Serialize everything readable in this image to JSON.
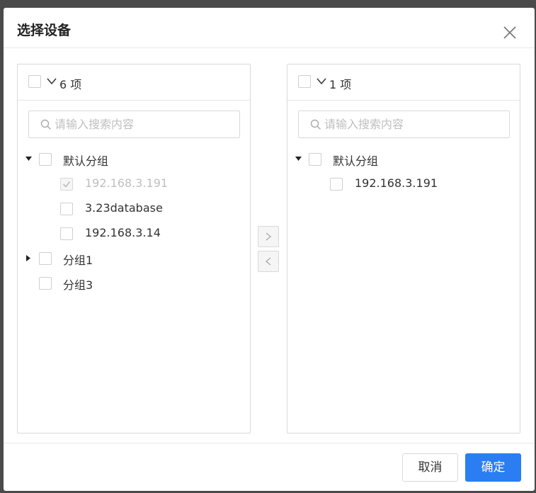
{
  "dialog": {
    "title": "选择设备",
    "close_icon": "close-icon"
  },
  "left_panel": {
    "count_label": "6 项",
    "search_placeholder": "请输入搜索内容",
    "tree": {
      "group_default": {
        "label": "默认分组",
        "expanded": true,
        "children": [
          {
            "label": "192.168.3.191",
            "checked": true,
            "disabled": true
          },
          {
            "label": "3.23database",
            "checked": false,
            "disabled": false
          },
          {
            "label": "192.168.3.14",
            "checked": false,
            "disabled": false
          }
        ]
      },
      "group_1": {
        "label": "分组1",
        "expanded": false
      },
      "group_3": {
        "label": "分组3"
      }
    }
  },
  "right_panel": {
    "count_label": "1 项",
    "search_placeholder": "请输入搜索内容",
    "tree": {
      "group_default": {
        "label": "默认分组",
        "expanded": true,
        "children": [
          {
            "label": "192.168.3.191",
            "checked": false
          }
        ]
      }
    }
  },
  "transfer": {
    "to_right_icon": "chevron-right-icon",
    "to_left_icon": "chevron-left-icon"
  },
  "footer": {
    "cancel_label": "取消",
    "ok_label": "确定"
  },
  "colors": {
    "primary": "#2a7ef2",
    "border": "#d9d9d9",
    "disabled_text": "#bfbfbf"
  }
}
